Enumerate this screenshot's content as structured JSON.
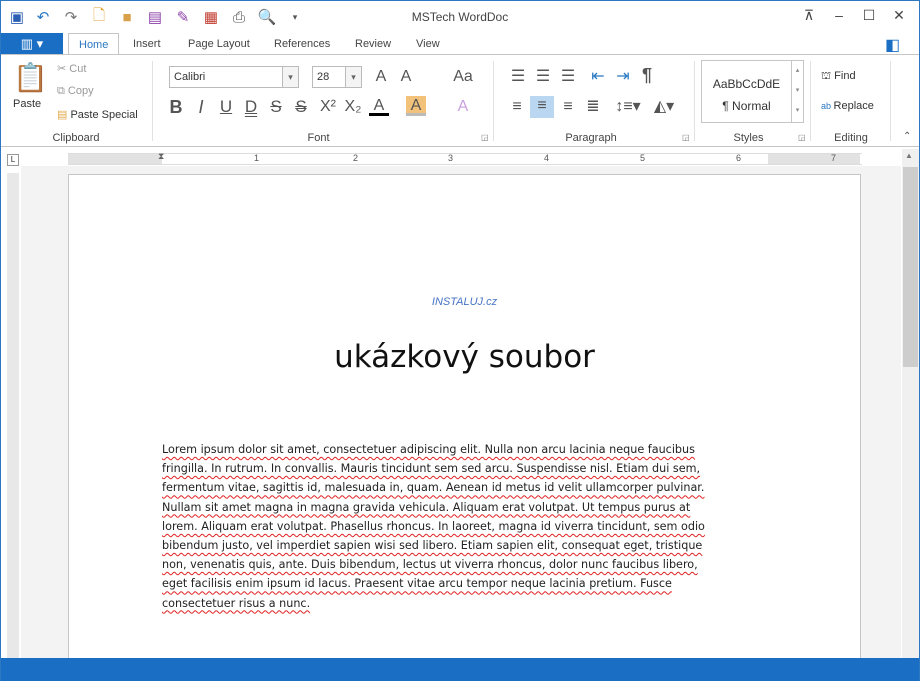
{
  "window": {
    "title": "MSTech WordDoc"
  },
  "quick_access": [
    "word-icon",
    "undo-icon",
    "redo-icon",
    "new-icon",
    "open-icon",
    "save-icon",
    "edit-icon",
    "pdf-icon",
    "print-icon",
    "print-preview-icon",
    "customize-icon"
  ],
  "tabs": [
    "Home",
    "Insert",
    "Page Layout",
    "References",
    "Review",
    "View"
  ],
  "clipboard": {
    "paste": "Paste",
    "cut": "Cut",
    "copy": "Copy",
    "paste_special": "Paste Special",
    "label": "Clipboard"
  },
  "font": {
    "name": "Calibri",
    "size": "28",
    "label": "Font",
    "bold": "B",
    "italic": "I",
    "underline": "U",
    "double_underline": "D",
    "strike": "S",
    "dstrike": "S",
    "superscript": "X²",
    "subscript": "X₂",
    "font_color": "A",
    "highlight": "A"
  },
  "paragraph": {
    "label": "Paragraph",
    "pilcrow": "¶"
  },
  "styles": {
    "preview": "AaBbCcDdE",
    "normal": "¶ Normal",
    "label": "Styles"
  },
  "editing": {
    "find": "Find",
    "replace": "Replace",
    "label": "Editing"
  },
  "ruler": {
    "numbers": [
      "1",
      "1",
      "2",
      "3",
      "4",
      "5",
      "6",
      "7"
    ]
  },
  "document": {
    "header": "INSTALUJ.cz",
    "title": "ukázkový soubor",
    "lines": [
      "Lorem ipsum dolor sit amet, consectetuer adipiscing elit. Nulla non arcu lacinia neque faucibus",
      "fringilla. In rutrum. In convallis. Mauris tincidunt sem sed arcu. Suspendisse nisl. Etiam dui sem,",
      "fermentum vitae, sagittis id, malesuada in, quam. Aenean id metus id velit ullamcorper pulvinar.",
      "Nullam sit amet magna in magna gravida vehicula. Aliquam erat volutpat. Ut tempus purus at",
      "lorem. Aliquam erat volutpat. Phasellus rhoncus. In laoreet, magna id viverra tincidunt, sem odio",
      "bibendum justo, vel imperdiet sapien wisi sed libero. Etiam sapien elit, consequat eget, tristique",
      "non, venenatis quis, ante. Duis bibendum, lectus ut viverra rhoncus, dolor nunc faucibus libero,",
      "eget facilisis enim ipsum id lacus. Praesent vitae arcu tempor neque lacinia pretium. Fusce",
      "consectetuer risus a nunc."
    ]
  }
}
